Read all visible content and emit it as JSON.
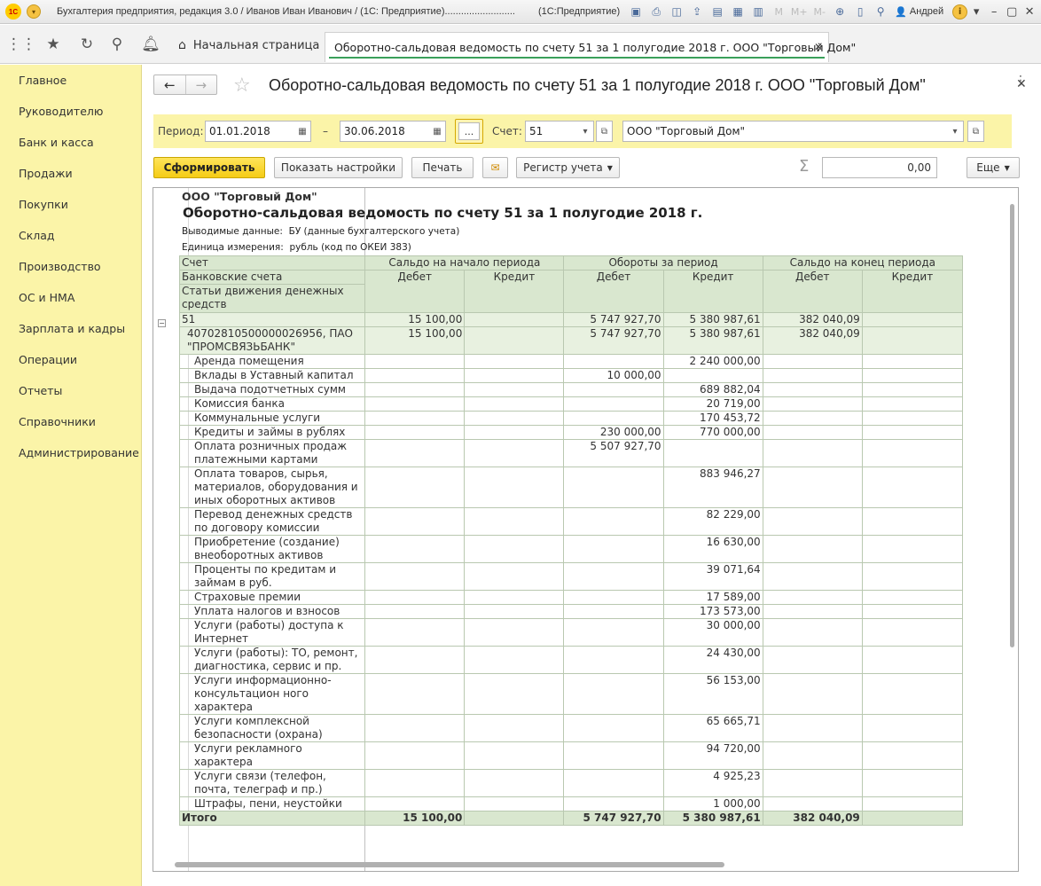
{
  "titlebar": {
    "logo": "1С",
    "title": "Бухгалтерия предприятия, редакция 3.0 / Иванов Иван Иванович / (1С: Предприятие)..........................",
    "app": "(1С:Предприятие)",
    "mem_labels": [
      "M",
      "M+",
      "M-"
    ],
    "user": "Андрей"
  },
  "nav": {
    "home_tab": "Начальная страница",
    "active_tab": "Оборотно-сальдовая ведомость по счету 51 за 1 полугодие 2018 г. ООО \"Торговый Дом\""
  },
  "sidebar": {
    "items": [
      {
        "label": "Главное"
      },
      {
        "label": "Руководителю"
      },
      {
        "label": "Банк и касса"
      },
      {
        "label": "Продажи"
      },
      {
        "label": "Покупки"
      },
      {
        "label": "Склад"
      },
      {
        "label": "Производство"
      },
      {
        "label": "ОС и НМА"
      },
      {
        "label": "Зарплата и кадры"
      },
      {
        "label": "Операции"
      },
      {
        "label": "Отчеты"
      },
      {
        "label": "Справочники"
      },
      {
        "label": "Администрирование"
      }
    ]
  },
  "form": {
    "title": "Оборотно-сальдовая ведомость по счету 51 за 1 полугодие 2018 г. ООО \"Торговый Дом\"",
    "period_label": "Период:",
    "date_from": "01.01.2018",
    "dash": "–",
    "date_to": "30.06.2018",
    "dots": "...",
    "account_label": "Счет:",
    "account": "51",
    "organization": "ООО \"Торговый Дом\"",
    "buttons": {
      "generate": "Сформировать",
      "settings": "Показать настройки",
      "print": "Печать",
      "register": "Регистр учета",
      "more": "Еще"
    },
    "sum_value": "0,00"
  },
  "report": {
    "org": "ООО \"Торговый Дом\"",
    "title": "Оборотно-сальдовая ведомость по счету 51 за 1 полугодие 2018 г.",
    "data_label": "Выводимые данные:",
    "data_value": "БУ (данные бухгалтерского учета)",
    "unit_label": "Единица измерения:",
    "unit_value": "рубль (код по ОКЕИ 383)",
    "header": {
      "account": "Счет",
      "bank_accounts": "Банковские счета",
      "cash_flow": "Статьи движения денежных средств",
      "opening": "Сальдо на начало периода",
      "turnover": "Обороты за период",
      "closing": "Сальдо на конец периода",
      "debit": "Дебет",
      "credit": "Кредит"
    },
    "account_row": {
      "name": "51",
      "open_dt": "15 100,00",
      "open_ct": "",
      "turn_dt": "5 747 927,70",
      "turn_ct": "5 380 987,61",
      "close_dt": "382 040,09",
      "close_ct": ""
    },
    "bank_row": {
      "name": "40702810500000026956, ПАО \"ПРОМСВЯЗЬБАНК\"",
      "open_dt": "15 100,00",
      "open_ct": "",
      "turn_dt": "5 747 927,70",
      "turn_ct": "5 380 987,61",
      "close_dt": "382 040,09",
      "close_ct": ""
    },
    "rows": [
      {
        "name": "Аренда помещения",
        "turn_dt": "",
        "turn_ct": "2 240 000,00"
      },
      {
        "name": "Вклады в Уставный капитал",
        "turn_dt": "10 000,00",
        "turn_ct": ""
      },
      {
        "name": "Выдача подотчетных сумм",
        "turn_dt": "",
        "turn_ct": "689 882,04"
      },
      {
        "name": "Комиссия банка",
        "turn_dt": "",
        "turn_ct": "20 719,00"
      },
      {
        "name": "Коммунальные услуги",
        "turn_dt": "",
        "turn_ct": "170 453,72"
      },
      {
        "name": "Кредиты и займы в рублях",
        "turn_dt": "230 000,00",
        "turn_ct": "770 000,00"
      },
      {
        "name": "Оплата розничных продаж платежными картами",
        "turn_dt": "5 507 927,70",
        "turn_ct": ""
      },
      {
        "name": "Оплата товаров, сырья, материалов, оборудования и иных оборотных активов",
        "turn_dt": "",
        "turn_ct": "883 946,27"
      },
      {
        "name": "Перевод денежных средств по договору комиссии",
        "turn_dt": "",
        "turn_ct": "82 229,00"
      },
      {
        "name": "Приобретение (создание) внеоборотных активов",
        "turn_dt": "",
        "turn_ct": "16 630,00"
      },
      {
        "name": "Проценты по кредитам и займам в руб.",
        "turn_dt": "",
        "turn_ct": "39 071,64"
      },
      {
        "name": "Страховые премии",
        "turn_dt": "",
        "turn_ct": "17 589,00"
      },
      {
        "name": "Уплата налогов и взносов",
        "turn_dt": "",
        "turn_ct": "173 573,00"
      },
      {
        "name": "Услуги (работы) доступа к Интернет",
        "turn_dt": "",
        "turn_ct": "30 000,00"
      },
      {
        "name": "Услуги (работы): ТО, ремонт, диагностика, сервис и пр.",
        "turn_dt": "",
        "turn_ct": "24 430,00"
      },
      {
        "name": "Услуги информационно-консультацион ного характера",
        "turn_dt": "",
        "turn_ct": "56 153,00"
      },
      {
        "name": "Услуги комплексной безопасности (охрана)",
        "turn_dt": "",
        "turn_ct": "65 665,71"
      },
      {
        "name": "Услуги рекламного характера",
        "turn_dt": "",
        "turn_ct": "94 720,00"
      },
      {
        "name": "Услуги связи (телефон, почта, телеграф и пр.)",
        "turn_dt": "",
        "turn_ct": "4 925,23"
      },
      {
        "name": "Штрафы, пени, неустойки",
        "turn_dt": "",
        "turn_ct": "1 000,00"
      }
    ],
    "total": {
      "name": "Итого",
      "open_dt": "15 100,00",
      "open_ct": "",
      "turn_dt": "5 747 927,70",
      "turn_ct": "5 380 987,61",
      "close_dt": "382 040,09",
      "close_ct": ""
    }
  },
  "colors": {
    "sidebar": "#fbf4a8",
    "primary_button": "#f5cc15",
    "table_header": "#d9e7cf",
    "accent_green": "#3aa05a"
  }
}
